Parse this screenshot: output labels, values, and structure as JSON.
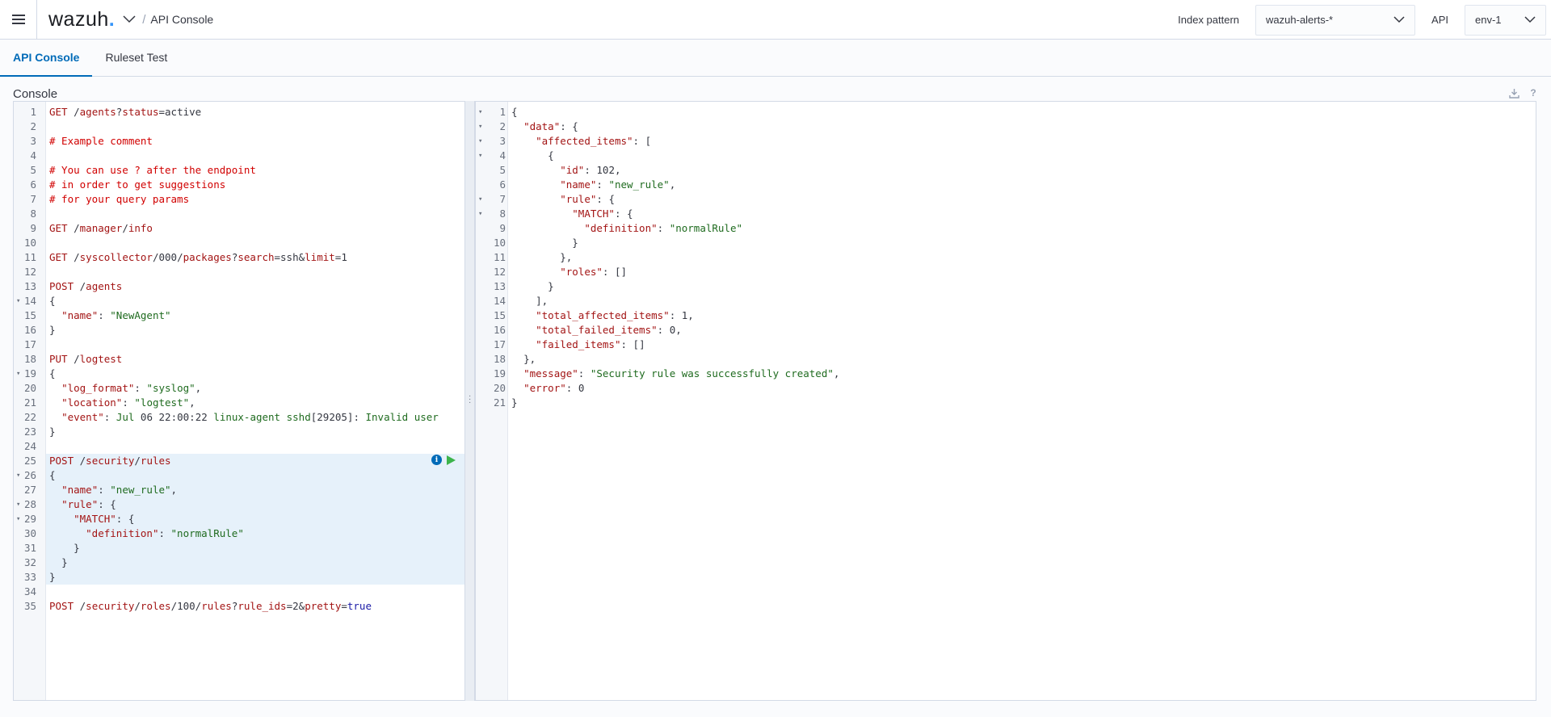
{
  "header": {
    "logo_text": "wazuh",
    "logo_dot": ".",
    "breadcrumb_sep": "/",
    "breadcrumb": "API Console",
    "index_pattern_label": "Index pattern",
    "index_pattern_value": "wazuh-alerts-*",
    "api_label": "API",
    "api_value": "env-1"
  },
  "tabs": [
    {
      "label": "API Console"
    },
    {
      "label": "Ruleset Test"
    }
  ],
  "console_title": "Console",
  "icons": {
    "download": "download-icon",
    "help": "?"
  },
  "colors": {
    "accent": "#006bb8",
    "run": "#3cb44b",
    "highlight": "#e6f1fa"
  },
  "left_editor": {
    "lines": [
      "GET /agents?status=active",
      "",
      "# Example comment",
      "",
      "# You can use ? after the endpoint",
      "# in order to get suggestions",
      "# for your query params",
      "",
      "GET /manager/info",
      "",
      "GET /syscollector/000/packages?search=ssh&limit=1",
      "",
      "POST /agents",
      "{",
      "  \"name\": \"NewAgent\"",
      "}",
      "",
      "PUT /logtest",
      "{",
      "  \"log_format\": \"syslog\",",
      "  \"location\": \"logtest\",",
      "  \"event\": \"Jul 06 22:00:22 linux-agent sshd[29205]: Invalid user",
      "}",
      "",
      "POST /security/rules",
      "{",
      "  \"name\": \"new_rule\",",
      "  \"rule\": {",
      "    \"MATCH\": {",
      "      \"definition\": \"normalRule\"",
      "    }",
      "  }",
      "}",
      "",
      "POST /security/roles/100/rules?rule_ids=2&pretty=true"
    ]
  },
  "right_editor": {
    "lines": [
      "{",
      "  \"data\": {",
      "    \"affected_items\": [",
      "      {",
      "        \"id\": 102,",
      "        \"name\": \"new_rule\",",
      "        \"rule\": {",
      "          \"MATCH\": {",
      "            \"definition\": \"normalRule\"",
      "          }",
      "        },",
      "        \"roles\": []",
      "      }",
      "    ],",
      "    \"total_affected_items\": 1,",
      "    \"total_failed_items\": 0,",
      "    \"failed_items\": []",
      "  },",
      "  \"message\": \"Security rule was successfully created\",",
      "  \"error\": 0",
      "}"
    ]
  }
}
